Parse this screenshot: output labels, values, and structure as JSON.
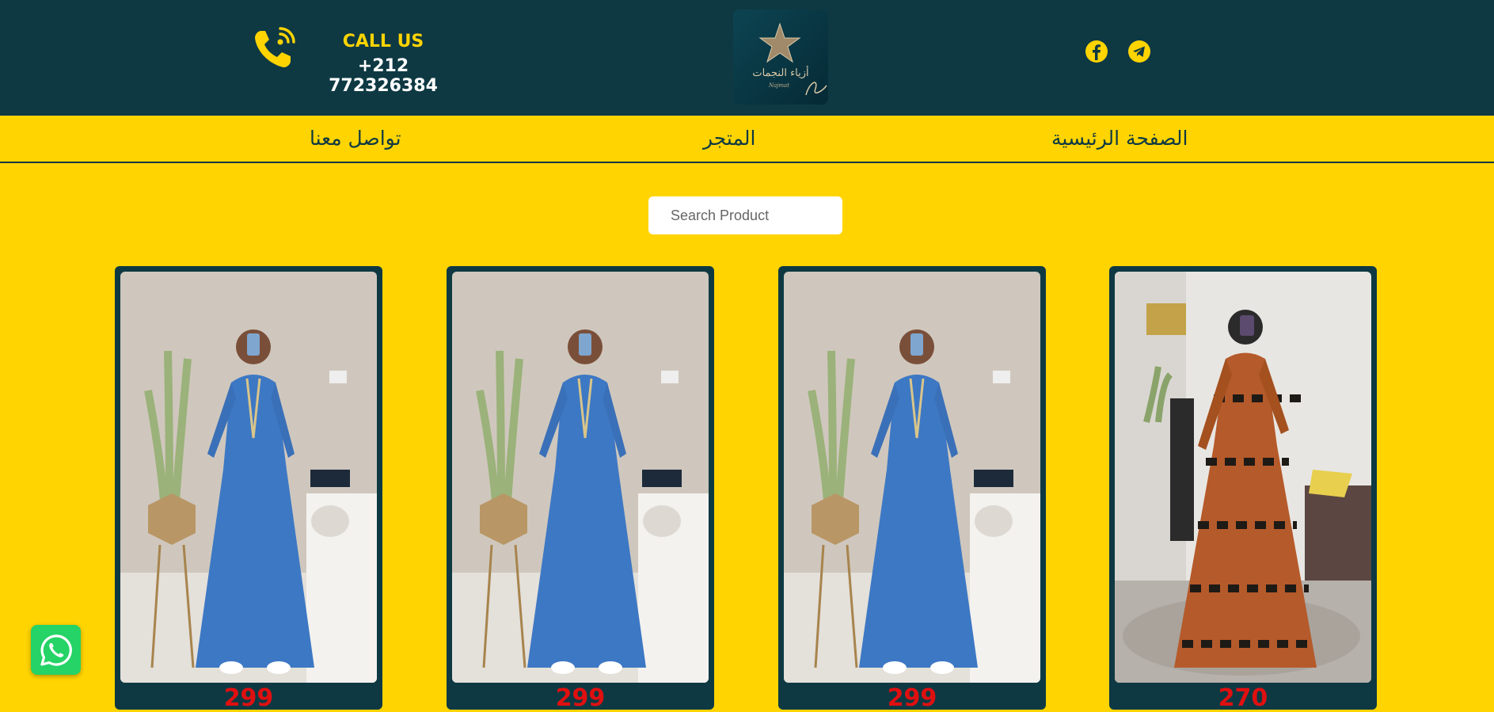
{
  "header": {
    "call_title": "CALL US",
    "call_number": "+212 772326384",
    "logo_text": "أزياء النجمات",
    "logo_subtext": "Najmat",
    "social": [
      {
        "name": "facebook-icon"
      },
      {
        "name": "telegram-icon"
      }
    ]
  },
  "nav": {
    "home": "الصفحة الرئيسية",
    "shop": "المتجر",
    "contact": "تواصل معنا"
  },
  "search": {
    "placeholder": "Search Product"
  },
  "products": [
    {
      "price": "299",
      "dress": "blue denim abaya"
    },
    {
      "price": "299",
      "dress": "blue denim abaya"
    },
    {
      "price": "299",
      "dress": "blue denim abaya"
    },
    {
      "price": "270",
      "dress": "orange patterned maxi dress"
    }
  ],
  "colors": {
    "brand_dark": "#0e3943",
    "brand_yellow": "#ffd400",
    "price_red": "#e01010",
    "whatsapp_green": "#25d366"
  }
}
